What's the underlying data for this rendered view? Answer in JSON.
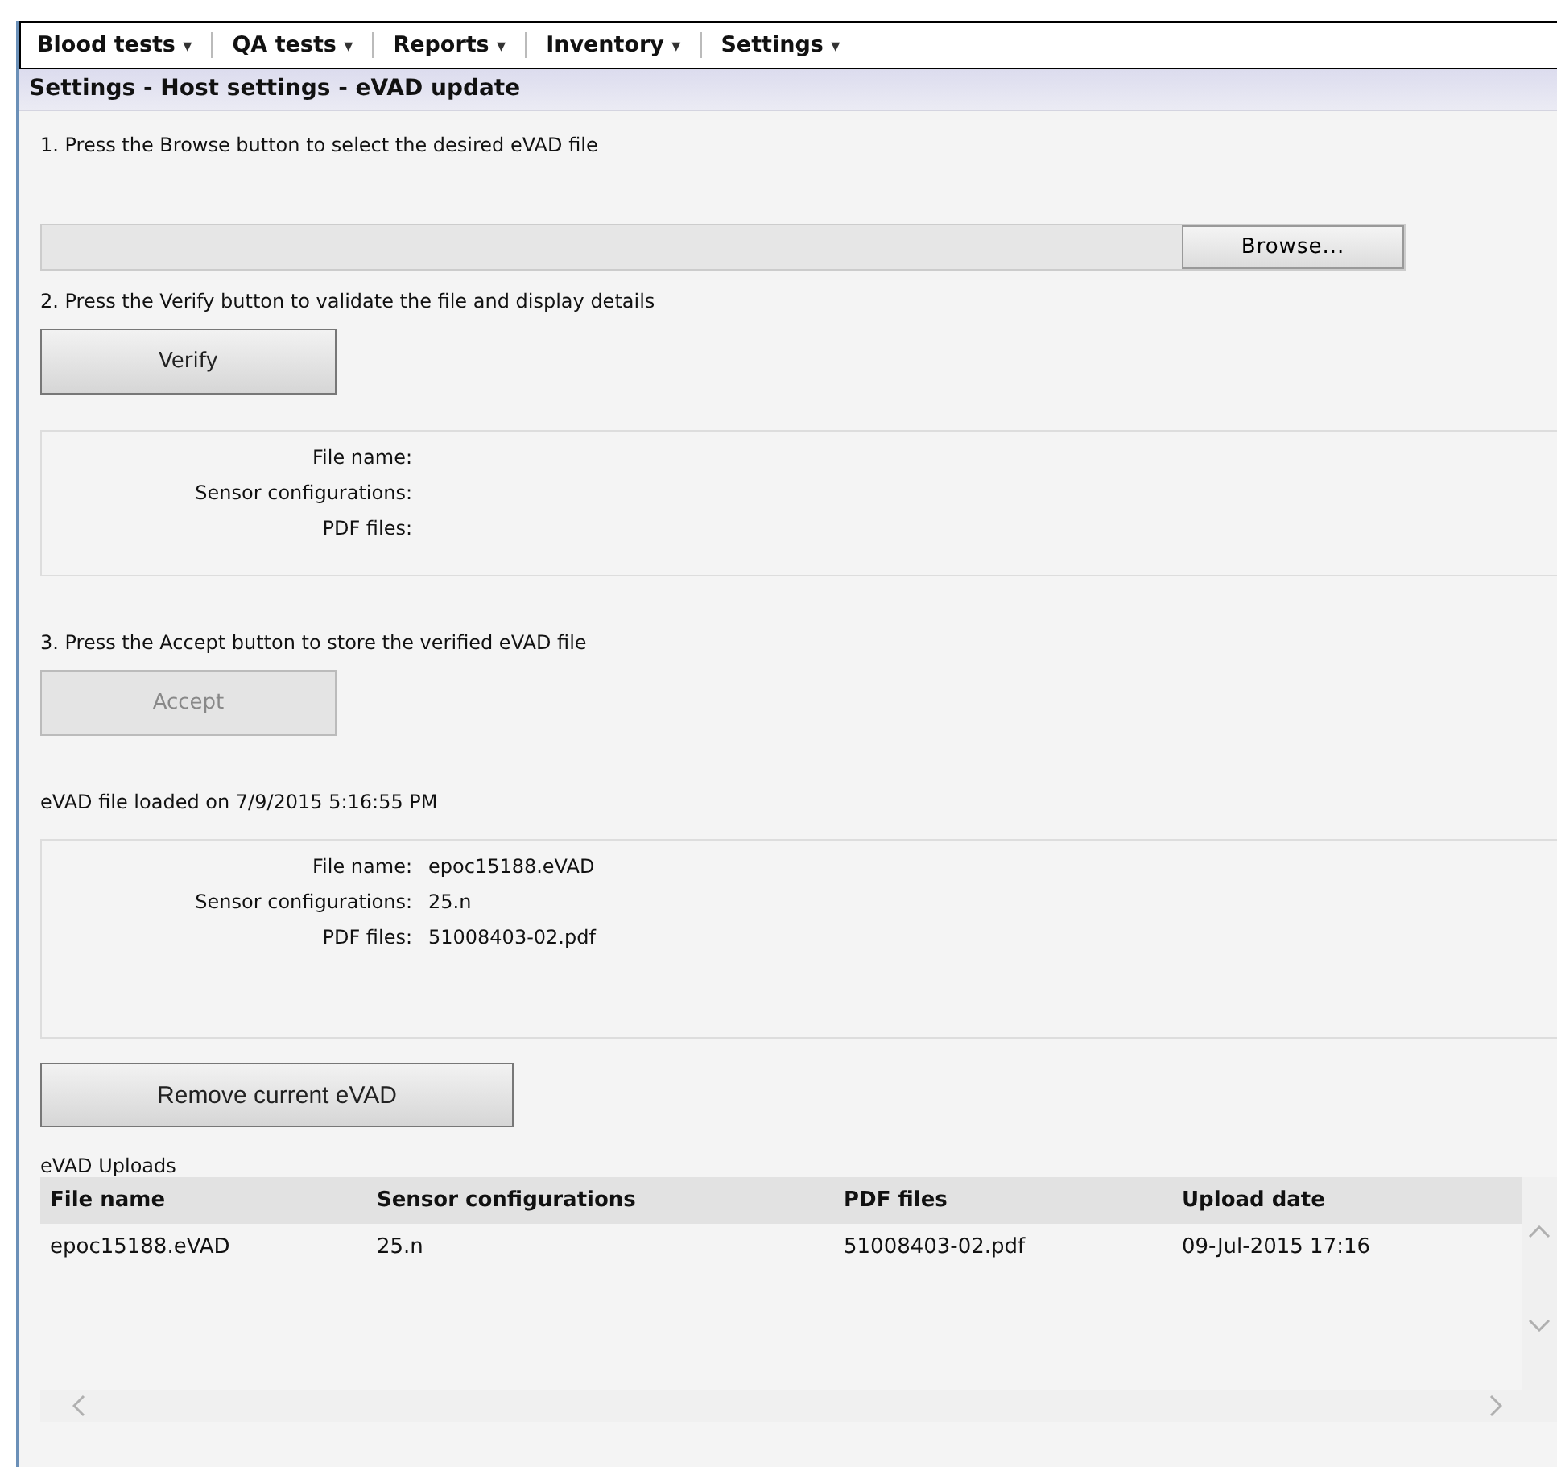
{
  "menu": [
    {
      "label": "Blood tests",
      "caret": "▾"
    },
    {
      "label": "QA tests",
      "caret": "▾"
    },
    {
      "label": "Reports",
      "caret": "▾"
    },
    {
      "label": "Inventory",
      "caret": "▾"
    },
    {
      "label": "Settings",
      "caret": "▾"
    }
  ],
  "page_title": "Settings - Host settings - eVAD update",
  "step1": {
    "text": "1. Press the Browse button to select the desired eVAD file",
    "browse_button": "Browse..."
  },
  "step2": {
    "text": "2. Press the Verify button to validate the file and display details",
    "button": {
      "label": "Verify",
      "disabled": false
    }
  },
  "verify_details": [
    {
      "label": "File name:"
    },
    {
      "label": "Sensor configurations:"
    },
    {
      "label": "PDF files:"
    }
  ],
  "step3": {
    "text": "3. Press the Accept button to store the verified eVAD file",
    "button": {
      "label": "Accept",
      "disabled": true
    }
  },
  "loaded_text": "eVAD file loaded on 7/9/2015 5:16:55 PM",
  "current_details": [
    {
      "label": "File name:",
      "value": "epoc15188.eVAD"
    },
    {
      "label": "Sensor configurations:",
      "value": "25.n"
    },
    {
      "label": "PDF files:",
      "value": "51008403-02.pdf"
    }
  ],
  "remove_button": {
    "label": "Remove current eVAD",
    "disabled": false
  },
  "uploads": {
    "title": "eVAD Uploads",
    "columns": [
      "File name",
      "Sensor configurations",
      "PDF files",
      "Upload date"
    ],
    "rows": [
      [
        "epoc15188.eVAD",
        "25.n",
        "51008403-02.pdf",
        "09-Jul-2015 17:16"
      ]
    ]
  }
}
